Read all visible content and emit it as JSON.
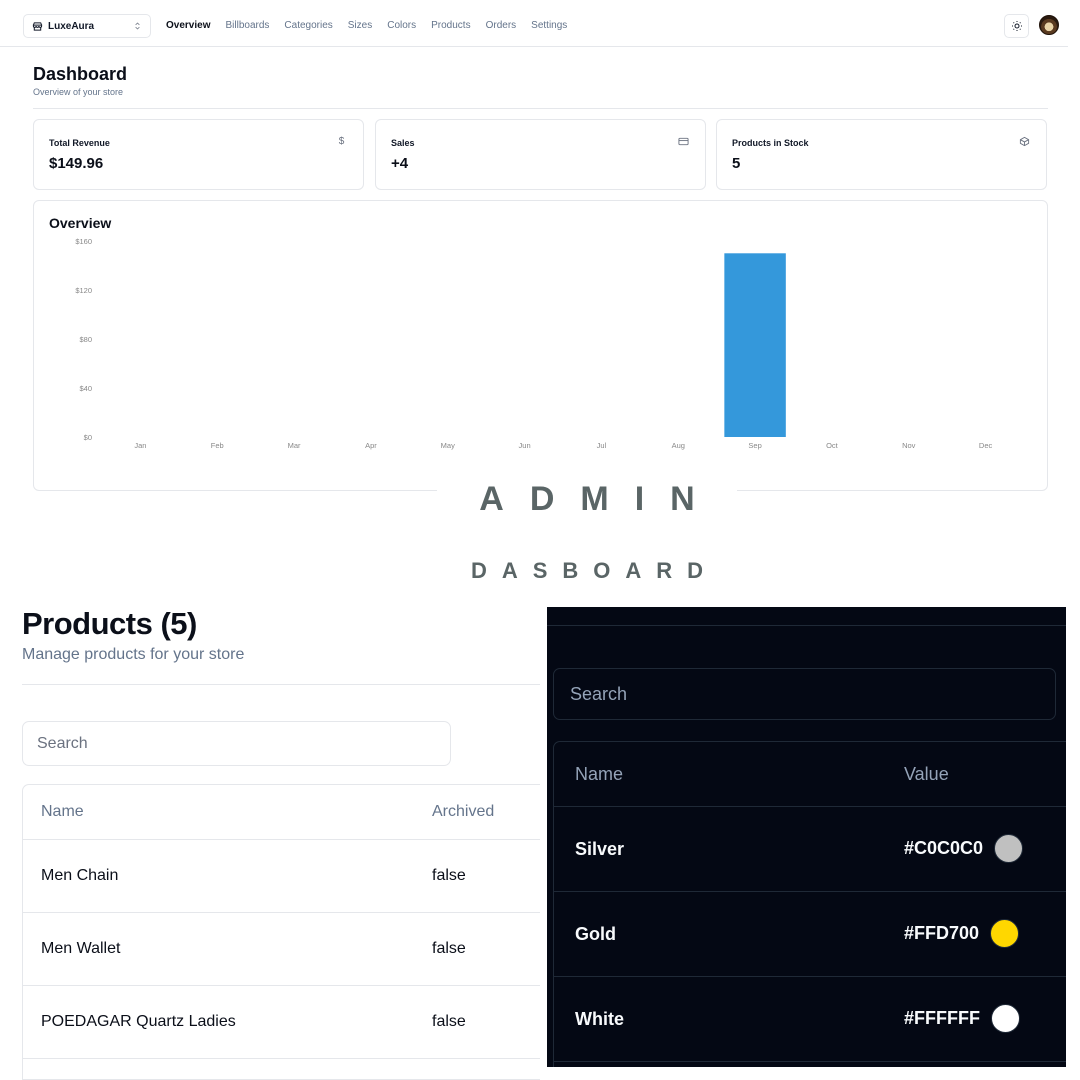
{
  "topbar": {
    "store_name": "LuxeAura",
    "nav": [
      "Overview",
      "Billboards",
      "Categories",
      "Sizes",
      "Colors",
      "Products",
      "Orders",
      "Settings"
    ],
    "active_nav": "Overview"
  },
  "dashboard": {
    "title": "Dashboard",
    "subtitle": "Overview of your store",
    "stats": [
      {
        "label": "Total Revenue",
        "value": "$149.96",
        "icon": "dollar-icon"
      },
      {
        "label": "Sales",
        "value": "+4",
        "icon": "credit-card-icon"
      },
      {
        "label": "Products in Stock",
        "value": "5",
        "icon": "package-icon"
      }
    ],
    "overview_title": "Overview"
  },
  "chart_data": {
    "type": "bar",
    "categories": [
      "Jan",
      "Feb",
      "Mar",
      "Apr",
      "May",
      "Jun",
      "Jul",
      "Aug",
      "Sep",
      "Oct",
      "Nov",
      "Dec"
    ],
    "values": [
      0,
      0,
      0,
      0,
      0,
      0,
      0,
      0,
      149.96,
      0,
      0,
      0
    ],
    "ylim": [
      0,
      160
    ],
    "yticks": [
      0,
      40,
      80,
      120,
      160
    ],
    "ytick_labels": [
      "$0",
      "$40",
      "$80",
      "$120",
      "$160"
    ],
    "bar_color": "#3498db",
    "grid": false
  },
  "banner": {
    "line1": "ADMIN",
    "line2": "DASBOARD"
  },
  "products": {
    "title": "Products (5)",
    "subtitle": "Manage products for your store",
    "search_placeholder": "Search",
    "columns": [
      "Name",
      "Archived"
    ],
    "rows": [
      [
        "Men Chain",
        "false"
      ],
      [
        "Men Wallet",
        "false"
      ],
      [
        "POEDAGAR Quartz Ladies",
        "false"
      ]
    ]
  },
  "colors": {
    "search_placeholder": "Search",
    "columns": [
      "Name",
      "Value"
    ],
    "rows": [
      {
        "name": "Silver",
        "value": "#C0C0C0",
        "swatch": "#C0C0C0"
      },
      {
        "name": "Gold",
        "value": "#FFD700",
        "swatch": "#FFD700"
      },
      {
        "name": "White",
        "value": "#FFFFFF",
        "swatch": "#FFFFFF"
      }
    ]
  }
}
